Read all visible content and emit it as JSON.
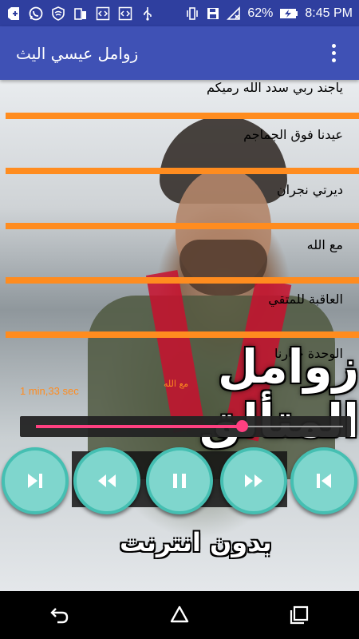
{
  "status_bar": {
    "battery_percent": "62%",
    "time": "8:45 PM"
  },
  "app_bar": {
    "title": "زوامل عيسي اليث"
  },
  "songs": [
    {
      "title": "ياجند ربي سدد الله رميكم"
    },
    {
      "title": "عيدنا فوق الجماجم"
    },
    {
      "title": "ديرتي نجران"
    },
    {
      "title": "مع الله"
    },
    {
      "title": "العاقبة للمتقي"
    },
    {
      "title": "الوحدة خيارنا"
    }
  ],
  "cover": {
    "title": "زوامل المتألق",
    "subtitle": "بدون انترنت"
  },
  "player": {
    "elapsed_text": "1 min,33 sec",
    "now_playing": "مع الله",
    "progress": 0.67,
    "accent_color": "#ff4081",
    "button_color": "#7fd6cd"
  },
  "icons": {
    "status_left": [
      "add-box-icon",
      "whatsapp-icon",
      "shield-icon",
      "phone-link-icon",
      "code-icon",
      "code-icon",
      "usb-icon"
    ],
    "status_right": [
      "vibrate-icon",
      "save-icon",
      "no-signal-icon",
      "battery-charging-icon"
    ],
    "controls": [
      "next-track-icon",
      "rewind-icon",
      "pause-icon",
      "fast-forward-icon",
      "previous-track-icon"
    ],
    "nav": [
      "back-icon",
      "home-icon",
      "recents-icon"
    ]
  }
}
